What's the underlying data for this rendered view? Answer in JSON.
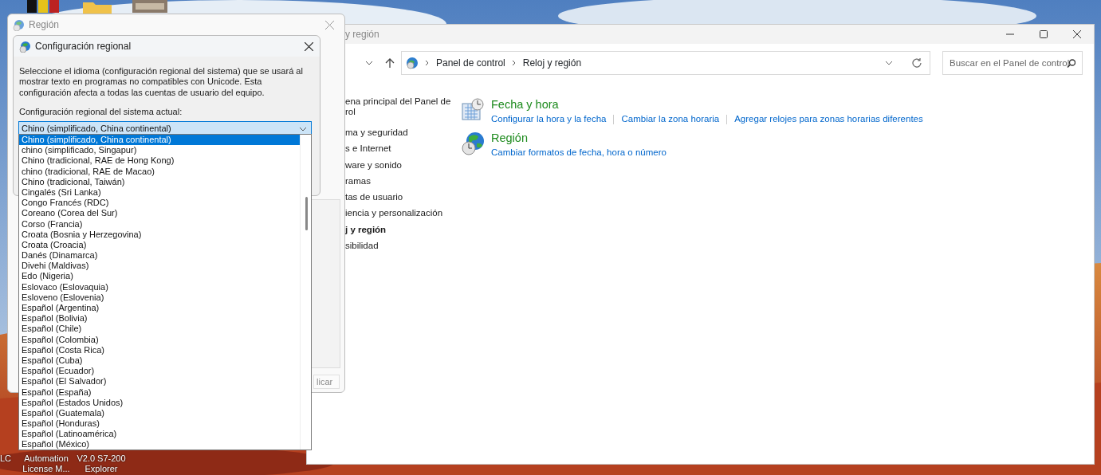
{
  "desktop": {
    "icons": [
      {
        "label": "LC",
        "kind": "app"
      },
      {
        "label": "Automation License M...",
        "kind": "app"
      },
      {
        "label": "V2.0 S7-200 Explorer",
        "kind": "app"
      }
    ]
  },
  "control_panel": {
    "title": "y región",
    "breadcrumb": [
      "Panel de control",
      "Reloj y región"
    ],
    "search": {
      "placeholder": "Buscar en el Panel de control"
    },
    "sidebar": {
      "items": [
        {
          "label": "ena principal del Panel de rol",
          "selected": false
        },
        {
          "label": "ma y seguridad",
          "selected": false
        },
        {
          "label": "s e Internet",
          "selected": false
        },
        {
          "label": "ware y sonido",
          "selected": false
        },
        {
          "label": "ramas",
          "selected": false
        },
        {
          "label": "tas de usuario",
          "selected": false
        },
        {
          "label": "iencia y personalización",
          "selected": false
        },
        {
          "label": "j y región",
          "selected": true
        },
        {
          "label": "sibilidad",
          "selected": false
        }
      ]
    },
    "categories": [
      {
        "title": "Fecha y hora",
        "kind": "clock",
        "links": [
          "Configurar la hora y la fecha",
          "Cambiar la zona horaria",
          "Agregar relojes para zonas horarias diferentes"
        ]
      },
      {
        "title": "Región",
        "kind": "globe",
        "links": [
          "Cambiar formatos de fecha, hora o número"
        ]
      }
    ]
  },
  "region_dialog": {
    "title": "Región",
    "apply_button": "licar"
  },
  "locale_dialog": {
    "title": "Configuración regional",
    "description": "Seleccione el idioma (configuración regional del sistema) que se usará al mostrar texto en programas no compatibles con Unicode. Esta configuración afecta a todas las cuentas de usuario del equipo.",
    "label": "Configuración regional del sistema actual:",
    "select": {
      "value": "Chino (simplificado, China continental)",
      "expanded": true
    },
    "options": [
      {
        "label": "Chino (simplificado, China continental)",
        "selected": true
      },
      {
        "label": "chino (simplificado, Singapur)",
        "selected": false
      },
      {
        "label": "Chino (tradicional, RAE de Hong Kong)",
        "selected": false
      },
      {
        "label": "chino (tradicional, RAE de Macao)",
        "selected": false
      },
      {
        "label": "Chino (tradicional, Taiwán)",
        "selected": false
      },
      {
        "label": "Cingalés (Sri Lanka)",
        "selected": false
      },
      {
        "label": "Congo Francés (RDC)",
        "selected": false
      },
      {
        "label": "Coreano (Corea del Sur)",
        "selected": false
      },
      {
        "label": "Corso (Francia)",
        "selected": false
      },
      {
        "label": "Croata (Bosnia y Herzegovina)",
        "selected": false
      },
      {
        "label": "Croata (Croacia)",
        "selected": false
      },
      {
        "label": "Danés (Dinamarca)",
        "selected": false
      },
      {
        "label": "Divehi (Maldivas)",
        "selected": false
      },
      {
        "label": "Edo (Nigeria)",
        "selected": false
      },
      {
        "label": "Eslovaco (Eslovaquia)",
        "selected": false
      },
      {
        "label": "Esloveno (Eslovenia)",
        "selected": false
      },
      {
        "label": "Español (Argentina)",
        "selected": false
      },
      {
        "label": "Español (Bolivia)",
        "selected": false
      },
      {
        "label": "Español (Chile)",
        "selected": false
      },
      {
        "label": "Español (Colombia)",
        "selected": false
      },
      {
        "label": "Español (Costa Rica)",
        "selected": false
      },
      {
        "label": "Español (Cuba)",
        "selected": false
      },
      {
        "label": "Español (Ecuador)",
        "selected": false
      },
      {
        "label": "Español (El Salvador)",
        "selected": false
      },
      {
        "label": "Español (España)",
        "selected": false
      },
      {
        "label": "Español (Estados Unidos)",
        "selected": false
      },
      {
        "label": "Español (Guatemala)",
        "selected": false
      },
      {
        "label": "Español (Honduras)",
        "selected": false
      },
      {
        "label": "Español (Latinoamérica)",
        "selected": false
      },
      {
        "label": "Español (México)",
        "selected": false
      }
    ]
  }
}
